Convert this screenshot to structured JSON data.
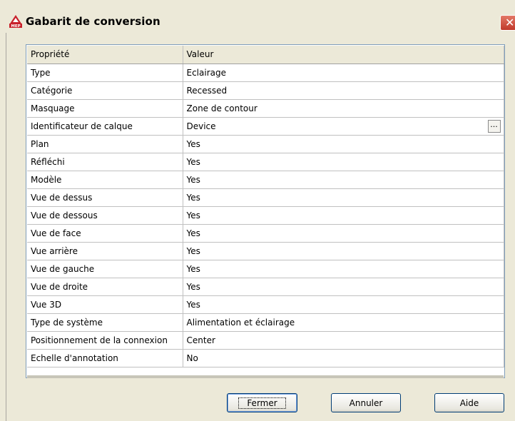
{
  "window": {
    "title": "Gabarit de conversion",
    "icon": "autocad-mep-icon",
    "close_symbol": "✕"
  },
  "grid": {
    "header": {
      "property": "Propriété",
      "value": "Valeur"
    },
    "rows": [
      {
        "property": "Type",
        "value": "Eclairage"
      },
      {
        "property": "Catégorie",
        "value": "Recessed"
      },
      {
        "property": "Masquage",
        "value": "Zone de contour"
      },
      {
        "property": "Identificateur de calque",
        "value": "Device",
        "has_button": true,
        "button_label": "..."
      },
      {
        "property": "Plan",
        "value": "Yes"
      },
      {
        "property": "Réfléchi",
        "value": "Yes"
      },
      {
        "property": "Modèle",
        "value": "Yes"
      },
      {
        "property": "Vue de dessus",
        "value": "Yes"
      },
      {
        "property": "Vue de dessous",
        "value": "Yes"
      },
      {
        "property": "Vue de face",
        "value": "Yes"
      },
      {
        "property": "Vue arrière",
        "value": "Yes"
      },
      {
        "property": "Vue de gauche",
        "value": "Yes"
      },
      {
        "property": "Vue de droite",
        "value": "Yes"
      },
      {
        "property": "Vue 3D",
        "value": "Yes"
      },
      {
        "property": "Type de système",
        "value": "Alimentation et éclairage"
      },
      {
        "property": "Positionnement de la connexion",
        "value": "Center"
      },
      {
        "property": "Echelle d'annotation",
        "value": "No"
      }
    ]
  },
  "buttons": {
    "close": "Fermer",
    "cancel": "Annuler",
    "help": "Aide"
  },
  "colors": {
    "dialog_bg": "#ece9d8",
    "grid_border": "#7f9db9",
    "close_button": "#c0392b"
  }
}
